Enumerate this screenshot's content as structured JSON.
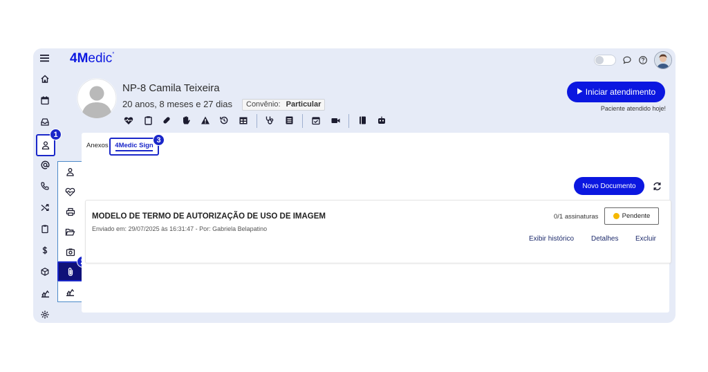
{
  "app": {
    "logo_prefix": "4M",
    "logo_suffix": "edic"
  },
  "patient": {
    "name": "NP-8 Camila Teixeira",
    "age": "20 anos, 8 meses e 27 dias",
    "convenio_label": "Convênio:",
    "convenio_value": "Particular"
  },
  "actions": {
    "start_label": "Iniciar atendimento",
    "attended_note": "Paciente atendido hoje!"
  },
  "tabs": [
    {
      "label": "Anexos"
    },
    {
      "label": "4Medic Sign"
    }
  ],
  "annotations": {
    "one": "1",
    "two": "2",
    "three": "3"
  },
  "new_document_label": "Novo Documento",
  "document": {
    "title": "MODELO DE TERMO DE AUTORIZAÇÃO DE USO DE IMAGEM",
    "meta": "Enviado em: 29/07/2025 às 16:31:47 - Por: Gabriela Belapatino",
    "signatures": "0/1 assinaturas",
    "status": "Pendente",
    "status_color": "#f5b800",
    "links": {
      "history": "Exibir histórico",
      "details": "Detalhes",
      "delete": "Excluir"
    }
  },
  "colors": {
    "accent": "#0b17e0",
    "frame_bg": "#e6ebf7"
  },
  "sidebar_icons": [
    "menu-icon",
    "home-icon",
    "calendar-icon",
    "inbox-icon",
    "patient-icon",
    "at-sign-icon",
    "phone-icon",
    "shuffle-icon",
    "clipboard-icon",
    "dollar-icon",
    "box-icon",
    "chart-icon",
    "settings-icon"
  ],
  "submenu_icons": [
    "person-icon",
    "heartbeat-icon",
    "printer-icon",
    "folder-open-icon",
    "camera-icon",
    "paperclip-icon",
    "chart-icon"
  ],
  "toolbar_icons": [
    "heart-pulse-icon",
    "clipboard-icon",
    "pill-icon",
    "hand-icon",
    "warning-icon",
    "history-icon",
    "table-icon",
    "stethoscope-icon",
    "list-icon",
    "calendar-check-icon",
    "video-icon",
    "book-icon",
    "robot-icon"
  ]
}
